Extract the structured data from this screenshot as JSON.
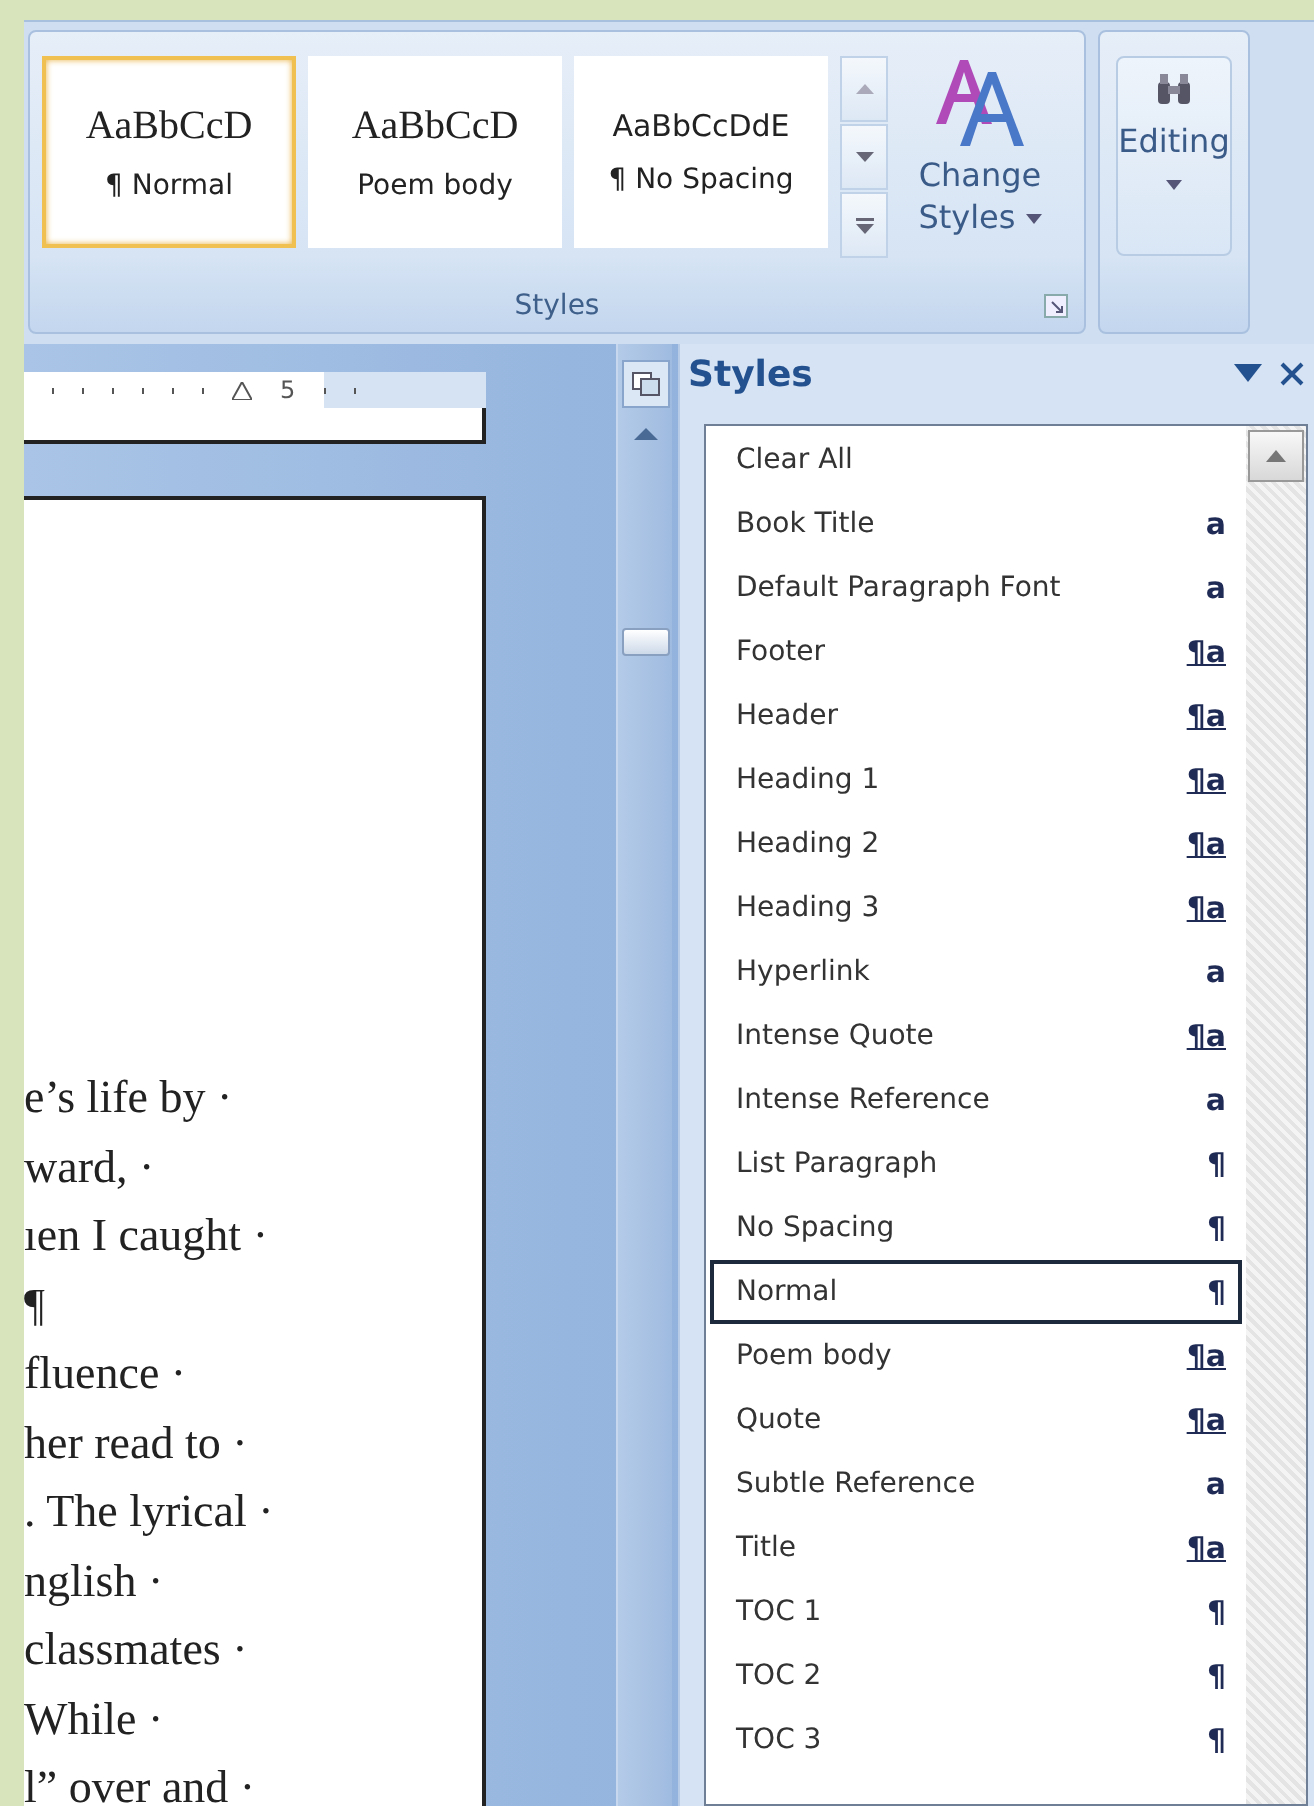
{
  "ribbon": {
    "styles_group": {
      "label": "Styles",
      "gallery": [
        {
          "sample": "AaBbCcD",
          "name": "¶ Normal",
          "selected": true,
          "kind": "serif"
        },
        {
          "sample": "AaBbCcD",
          "name": "Poem body",
          "selected": false,
          "kind": "serif"
        },
        {
          "sample": "AaBbCcDdE",
          "name": "¶ No Spacing",
          "selected": false,
          "kind": "sans"
        }
      ],
      "change_styles": {
        "line1": "Change",
        "line2": "Styles"
      }
    },
    "editing_group": {
      "label": "Editing"
    }
  },
  "ruler": {
    "label": "5"
  },
  "document": {
    "lines": [
      "e’s life by ·",
      "ward, ·",
      "ıen I caught ·",
      "¶",
      "fluence ·",
      "her read to ·",
      ". The lyrical ·",
      "nglish ·",
      "classmates ·",
      "While ·",
      "l” over and ·"
    ]
  },
  "styles_pane": {
    "title": "Styles",
    "items": [
      {
        "name": "Clear All",
        "kind": "none",
        "selected": false
      },
      {
        "name": "Book Title",
        "kind": "character",
        "mark": "a",
        "selected": false
      },
      {
        "name": "Default Paragraph Font",
        "kind": "character",
        "mark": "a",
        "selected": false
      },
      {
        "name": "Footer",
        "kind": "linked",
        "mark": "¶a",
        "selected": false
      },
      {
        "name": "Header",
        "kind": "linked",
        "mark": "¶a",
        "selected": false
      },
      {
        "name": "Heading 1",
        "kind": "linked",
        "mark": "¶a",
        "selected": false
      },
      {
        "name": "Heading 2",
        "kind": "linked",
        "mark": "¶a",
        "selected": false
      },
      {
        "name": "Heading 3",
        "kind": "linked",
        "mark": "¶a",
        "selected": false
      },
      {
        "name": "Hyperlink",
        "kind": "character",
        "mark": "a",
        "selected": false
      },
      {
        "name": "Intense Quote",
        "kind": "linked",
        "mark": "¶a",
        "selected": false
      },
      {
        "name": "Intense Reference",
        "kind": "character",
        "mark": "a",
        "selected": false
      },
      {
        "name": "List Paragraph",
        "kind": "paragraph",
        "mark": "¶",
        "selected": false
      },
      {
        "name": "No Spacing",
        "kind": "paragraph",
        "mark": "¶",
        "selected": false
      },
      {
        "name": "Normal",
        "kind": "paragraph",
        "mark": "¶",
        "selected": true
      },
      {
        "name": "Poem body",
        "kind": "linked",
        "mark": "¶a",
        "selected": false
      },
      {
        "name": "Quote",
        "kind": "linked",
        "mark": "¶a",
        "selected": false
      },
      {
        "name": "Subtle Reference",
        "kind": "character",
        "mark": "a",
        "selected": false
      },
      {
        "name": "Title",
        "kind": "linked",
        "mark": "¶a",
        "selected": false
      },
      {
        "name": "TOC 1",
        "kind": "paragraph",
        "mark": "¶",
        "selected": false
      },
      {
        "name": "TOC 2",
        "kind": "paragraph",
        "mark": "¶",
        "selected": false
      },
      {
        "name": "TOC 3",
        "kind": "paragraph",
        "mark": "¶",
        "selected": false
      }
    ]
  }
}
